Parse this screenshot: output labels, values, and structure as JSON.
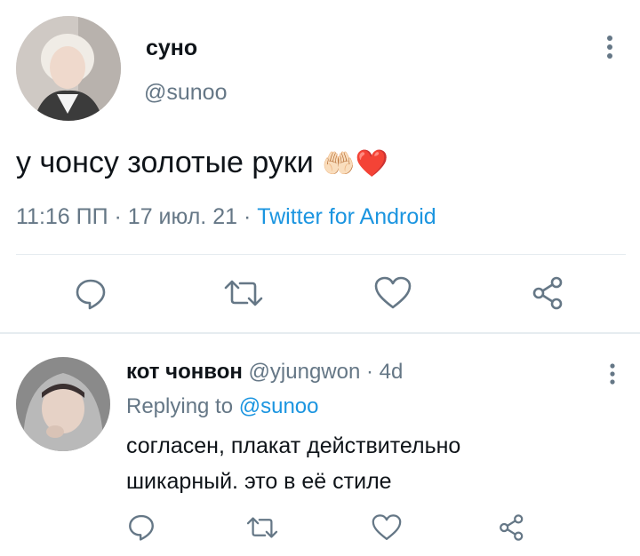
{
  "tweet": {
    "display_name": "суно",
    "handle": "@sunoo",
    "text": "у чонсу золотые руки",
    "emoji": "🤲🏻❤️",
    "timestamp": "11:16 ПП · 17 июл. 21 · ",
    "source": "Twitter for Android"
  },
  "reply": {
    "display_name": "кот чонвон",
    "handle_time": "@yjungwon · 4d",
    "replying_prefix": "Replying to ",
    "replying_to": "@sunoo",
    "text_line1": "согласен, плакат действительно",
    "text_line2": "шикарный. это в её стиле"
  },
  "icons": {
    "reply": "comment-bubble-icon",
    "retweet": "retweet-icon",
    "like": "heart-icon",
    "share": "share-icon",
    "more": "more-vertical-icon"
  },
  "colors": {
    "text": "#0f1419",
    "muted": "#657786",
    "link": "#1b95e0",
    "heart_emoji": "#e0245e"
  }
}
